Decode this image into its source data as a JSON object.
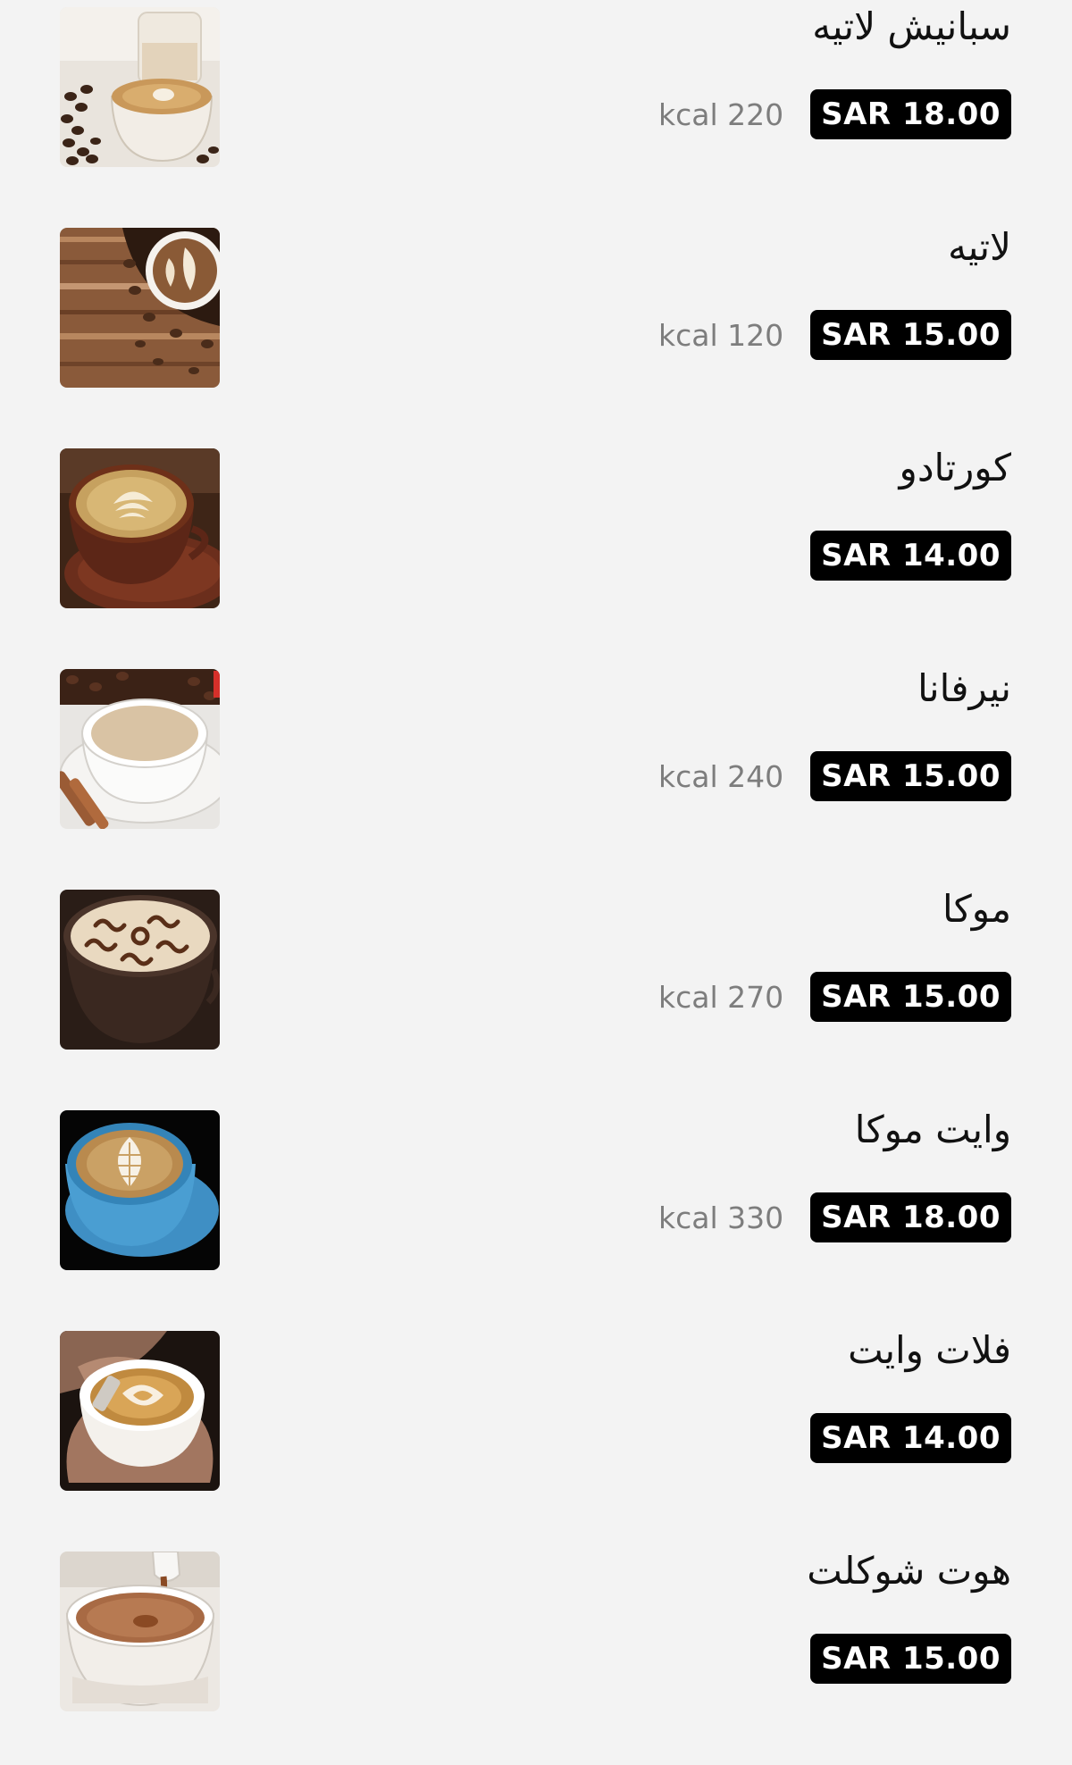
{
  "menu": {
    "items": [
      {
        "name": "سبانيش لاتيه",
        "price": "SAR 18.00",
        "kcal": "kcal 220",
        "image": "spanish-latte-photo"
      },
      {
        "name": "لاتيه",
        "price": "SAR 15.00",
        "kcal": "kcal 120",
        "image": "latte-photo"
      },
      {
        "name": "كورتادو",
        "price": "SAR 14.00",
        "kcal": "",
        "image": "cortado-photo"
      },
      {
        "name": "نيرفانا",
        "price": "SAR 15.00",
        "kcal": "kcal 240",
        "image": "nirvana-photo"
      },
      {
        "name": "موكا",
        "price": "SAR 15.00",
        "kcal": "kcal 270",
        "image": "mocha-photo"
      },
      {
        "name": "وايت موكا",
        "price": "SAR 18.00",
        "kcal": "kcal 330",
        "image": "white-mocha-photo"
      },
      {
        "name": "فلات وايت",
        "price": "SAR 14.00",
        "kcal": "",
        "image": "flat-white-photo"
      },
      {
        "name": "هوت شوكلت",
        "price": "SAR 15.00",
        "kcal": "",
        "image": "hot-chocolate-photo"
      }
    ]
  },
  "colors": {
    "background": "#f3f3f3",
    "price_badge_bg": "#000000",
    "price_badge_text": "#ffffff",
    "kcal_text": "#7d7d7d"
  }
}
